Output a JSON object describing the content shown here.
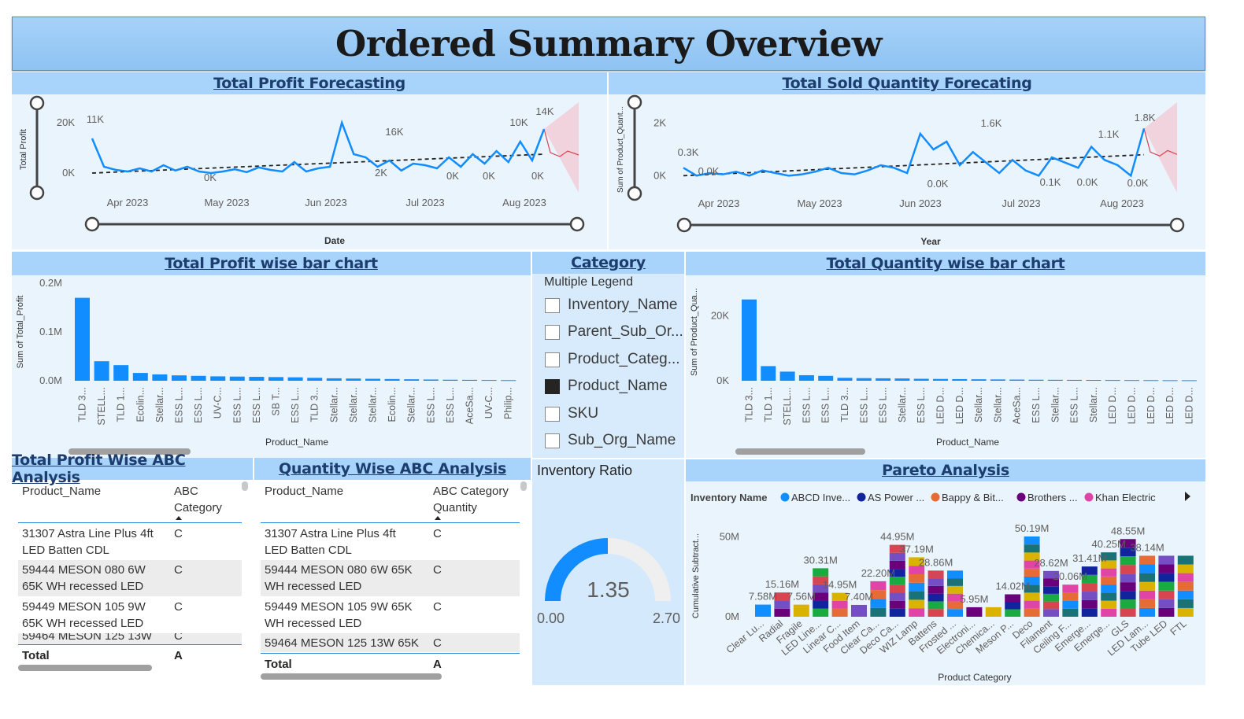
{
  "banner": {
    "title": "Ordered Summary Overview"
  },
  "profit_forecast": {
    "title": "Total Profit Forecasting",
    "ylabel": "Total Profit",
    "xlabel": "Date",
    "y_ticks": [
      "20K",
      "0K"
    ],
    "x_ticks": [
      "Apr 2023",
      "May 2023",
      "Jun 2023",
      "Jul 2023",
      "Aug 2023"
    ],
    "point_labels": [
      "11K",
      "0K",
      "16K",
      "2K",
      "0K",
      "0K",
      "10K",
      "14K",
      "0K"
    ]
  },
  "qty_forecast": {
    "title": "Total Sold Quantity Forecating",
    "ylabel": "Sum of Product_Quant...",
    "xlabel": "Year",
    "y_ticks": [
      "2K",
      "0K"
    ],
    "x_ticks": [
      "Apr 2023",
      "May 2023",
      "Jun 2023",
      "Jul 2023",
      "Aug 2023"
    ],
    "point_labels": [
      "0.3K",
      "0.0K",
      "1.6K",
      "0.0K",
      "0.1K",
      "0.0K",
      "1.1K",
      "1.8K",
      "0.0K"
    ]
  },
  "profit_bar": {
    "title": "Total Profit wise bar chart",
    "ylabel": "Sum of Total_Profit",
    "xlabel": "Product_Name",
    "y_ticks": [
      "0.2M",
      "0.1M",
      "0.0M"
    ],
    "categories": [
      "TLD 3...",
      "STELL...",
      "TLD 1...",
      "Ecolin...",
      "Stellar...",
      "ESS L...",
      "ESS L...",
      "UV-C...",
      "ESS L...",
      "ESS L...",
      "SB T...",
      "ESS L...",
      "TLD 3...",
      "Stellar...",
      "Stellar...",
      "Stellar...",
      "Ecolin...",
      "Stellar...",
      "ESS L...",
      "ESS L...",
      "AceSa...",
      "UV-C...",
      "Philip..."
    ]
  },
  "category_slicer": {
    "title": "Category",
    "subtitle": "Multiple Legend",
    "items": [
      "Inventory_Name",
      "Parent_Sub_Or...",
      "Product_Categ...",
      "Product_Name",
      "SKU",
      "Sub_Org_Name"
    ],
    "selected": "Product_Name"
  },
  "qty_bar": {
    "title": "Total Quantity wise bar chart",
    "ylabel": "Sum of Product_Qua...",
    "xlabel": "Product_Name",
    "y_ticks": [
      "20K",
      "0K"
    ],
    "categories": [
      "TLD 3...",
      "TLD 1...",
      "STELL...",
      "ESS L...",
      "ESS L...",
      "TLD 3...",
      "ESS L...",
      "ESS L...",
      "Stellar...",
      "ESS L...",
      "LED D...",
      "LED D...",
      "Stellar...",
      "Stellar...",
      "AceSa...",
      "ESS L...",
      "Stellar...",
      "ESS L...",
      "Stellar...",
      "LED D...",
      "LED D...",
      "LED D...",
      "LED D...",
      "LED D..."
    ]
  },
  "profit_abc": {
    "title": "Total Profit Wise ABC Analysis",
    "col1": "Product_Name",
    "col2_line1": "ABC",
    "col2_line2": "Category",
    "rows": [
      {
        "l1": "31307 Astra Line Plus 4ft",
        "l2": "LED Batten CDL",
        "cat": "C"
      },
      {
        "l1": "59444 MESON 080 6W",
        "l2": "65K WH recessed LED",
        "cat": "C"
      },
      {
        "l1": "59449 MESON 105 9W",
        "l2": "65K WH recessed LED",
        "cat": "C"
      },
      {
        "l1": "59464 MESON 125 13W",
        "l2": "",
        "cat": "C"
      }
    ],
    "total_label": "Total",
    "total_value": "A"
  },
  "qty_abc": {
    "title": "Quantity Wise ABC Analysis",
    "col1": "Product_Name",
    "col2_line1": "ABC Category",
    "col2_line2": "Quantity",
    "rows": [
      {
        "l1": "31307 Astra Line Plus 4ft",
        "l2": "LED Batten CDL",
        "cat": "C"
      },
      {
        "l1": "59444 MESON 080 6W 65K",
        "l2": "WH recessed LED",
        "cat": "C"
      },
      {
        "l1": "59449 MESON 105 9W 65K",
        "l2": "WH recessed LED",
        "cat": "C"
      },
      {
        "l1": "59464 MESON 125 13W 65K",
        "l2": "",
        "cat": "C"
      }
    ],
    "total_label": "Total",
    "total_value": "A"
  },
  "inventory_ratio": {
    "title": "Inventory Ratio",
    "value": "1.35",
    "min": "0.00",
    "max": "2.70",
    "fraction": 0.5
  },
  "pareto": {
    "title": "Pareto Analysis",
    "legend_title": "Inventory Name",
    "legend": [
      {
        "name": "ABCD Inve...",
        "color": "#118dff"
      },
      {
        "name": "AS Power ...",
        "color": "#12239e"
      },
      {
        "name": "Bappy & Bit...",
        "color": "#e66c37"
      },
      {
        "name": "Brothers ...",
        "color": "#6b007b"
      },
      {
        "name": "Khan Electric",
        "color": "#e044a7"
      }
    ],
    "ylabel": "Cumulative Subtract...",
    "xlabel": "Product Category",
    "y_ticks": [
      "50M",
      "0M"
    ],
    "categories": [
      "Clear Lu...",
      "Radial",
      "Fragile",
      "LED Line...",
      "Linear C...",
      "Food Item",
      "Clear Ca...",
      "Deco Ca...",
      "WIZ Lamp",
      "Battens",
      "Frosted ...",
      "Electroni...",
      "Chemica...",
      "Meson P...",
      "Deco",
      "Filament",
      "Ceiling F...",
      "Emerge...",
      "Emerge...",
      "GLS",
      "LED Lam...",
      "Tube LED",
      "FTL"
    ],
    "value_labels": [
      "7.58M",
      "15.16M",
      "7.56M",
      "30.31M",
      "14.95M",
      "7.40M",
      "22.20M",
      "44.95M",
      "37.19M",
      "28.86M",
      "5.95M",
      "14.02M",
      "50.19M",
      "28.62M",
      "20.06M",
      "31.41M",
      "40.25M",
      "48.55M",
      "38.14M"
    ]
  },
  "chart_data": [
    {
      "type": "line",
      "title": "Total Profit Forecasting",
      "xlabel": "Date",
      "ylabel": "Total Profit",
      "x": [
        "Apr 2023",
        "May 2023",
        "Jun 2023",
        "Jul 2023",
        "Aug 2023"
      ],
      "ylim": [
        -5000,
        20000
      ],
      "series": [
        {
          "values": [
            11000,
            2000,
            1000,
            500,
            1500,
            500,
            2500,
            800,
            2000,
            500,
            0,
            500,
            1200,
            300,
            1800,
            1000,
            500,
            3500,
            500,
            1500,
            2000,
            16000,
            6000,
            5000,
            2000,
            4000,
            800,
            3000,
            2500,
            1500,
            5000,
            2000,
            6000,
            3000,
            7000,
            3500,
            10000,
            4000,
            14000
          ]
        }
      ]
    },
    {
      "type": "line",
      "title": "Total Sold Quantity Forecating",
      "xlabel": "Year",
      "ylabel": "Sum of Product_Quant...",
      "x": [
        "Apr 2023",
        "May 2023",
        "Jun 2023",
        "Jul 2023",
        "Aug 2023"
      ],
      "ylim": [
        -500,
        2500
      ],
      "series": [
        {
          "values": [
            300,
            0,
            100,
            50,
            150,
            0,
            200,
            100,
            0,
            50,
            150,
            300,
            100,
            50,
            200,
            400,
            300,
            100,
            1600,
            1000,
            1300,
            400,
            900,
            500,
            100,
            600,
            200,
            0,
            700,
            500,
            300,
            1100,
            600,
            400,
            0,
            1800
          ]
        }
      ]
    },
    {
      "type": "bar",
      "title": "Total Profit wise bar chart",
      "xlabel": "Product_Name",
      "ylabel": "Sum of Total_Profit",
      "ylim": [
        0,
        200000
      ],
      "categories": [
        "TLD 3...",
        "STELL...",
        "TLD 1...",
        "Ecolin...",
        "Stellar...",
        "ESS L...",
        "ESS L...",
        "UV-C...",
        "ESS L...",
        "ESS L...",
        "SB T...",
        "ESS L...",
        "TLD 3...",
        "Stellar...",
        "Stellar...",
        "Stellar...",
        "Ecolin...",
        "Stellar...",
        "ESS L...",
        "ESS L...",
        "AceSa...",
        "UV-C...",
        "Philip..."
      ],
      "values": [
        170000,
        40000,
        32000,
        16000,
        13000,
        11000,
        10000,
        9000,
        8500,
        8000,
        7500,
        7000,
        6000,
        5000,
        4500,
        4000,
        3500,
        3000,
        2500,
        2000,
        1800,
        1500,
        1200
      ]
    },
    {
      "type": "bar",
      "title": "Total Quantity wise bar chart",
      "xlabel": "Product_Name",
      "ylabel": "Sum of Product_Qua...",
      "ylim": [
        0,
        30000
      ],
      "categories": [
        "TLD 3...",
        "TLD 1...",
        "STELL...",
        "ESS L...",
        "ESS L...",
        "TLD 3...",
        "ESS L...",
        "ESS L...",
        "Stellar...",
        "ESS L...",
        "LED D...",
        "LED D...",
        "Stellar...",
        "Stellar...",
        "AceSa...",
        "ESS L...",
        "Stellar...",
        "ESS L...",
        "Stellar...",
        "LED D...",
        "LED D...",
        "LED D...",
        "LED D...",
        "LED D..."
      ],
      "values": [
        25000,
        4500,
        2800,
        1700,
        1500,
        900,
        800,
        750,
        700,
        600,
        550,
        500,
        450,
        400,
        350,
        300,
        280,
        260,
        240,
        220,
        200,
        180,
        160,
        150
      ]
    },
    {
      "type": "bar",
      "title": "Pareto Analysis",
      "xlabel": "Product Category",
      "ylabel": "Cumulative Subtract...",
      "ylim": [
        0,
        60000000
      ],
      "categories": [
        "Clear Lu...",
        "Radial",
        "Fragile",
        "LED Line...",
        "Linear C...",
        "Food Item",
        "Clear Ca...",
        "Deco Ca...",
        "WIZ Lamp",
        "Battens",
        "Frosted ...",
        "Electroni...",
        "Chemica...",
        "Meson P...",
        "Deco",
        "Filament",
        "Ceiling F...",
        "Emerge...",
        "Emerge...",
        "GLS",
        "LED Lam...",
        "Tube LED",
        "FTL"
      ],
      "values": [
        7580000,
        15160000,
        7560000,
        30310000,
        14950000,
        7400000,
        22200000,
        44950000,
        37190000,
        28860000,
        28860000,
        5950000,
        5950000,
        14020000,
        50190000,
        28620000,
        20060000,
        31410000,
        40250000,
        48550000,
        38140000,
        38140000,
        38140000
      ]
    }
  ]
}
